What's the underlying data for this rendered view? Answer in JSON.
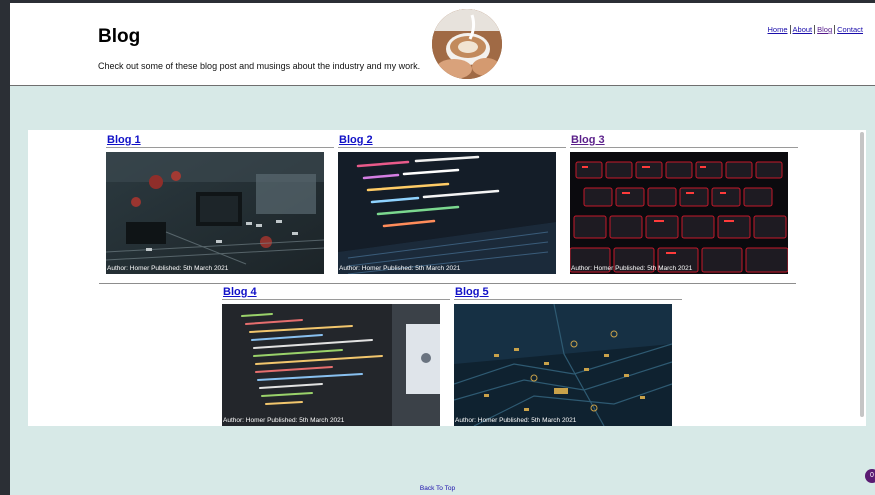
{
  "header": {
    "title": "Blog",
    "description": "Check out some of these blog post and musings about the industry and my work.",
    "image_icon": "coffee-cup-icon"
  },
  "nav": {
    "items": [
      "Home",
      "About",
      "Blog",
      "Contact"
    ]
  },
  "posts": [
    {
      "title": "Blog 1",
      "caption": "Author: Homer Published: 5th March 2021",
      "image": "circuit-board"
    },
    {
      "title": "Blog 2",
      "caption": "Author: Homer Published: 5th March 2021",
      "image": "laptop-code"
    },
    {
      "title": "Blog 3",
      "caption": "Author: Homer Published: 5th March 2021",
      "image": "red-keyboard"
    },
    {
      "title": "Blog 4",
      "caption": "Author: Homer Published: 5th March 2021",
      "image": "code-screen"
    },
    {
      "title": "Blog 5",
      "caption": "Author: Homer Published: 5th March 2021",
      "image": "blue-pcb"
    }
  ],
  "footer": {
    "back_to_top": "Back To Top",
    "badge": "0"
  },
  "colors": {
    "page_background": "#d7e9e7",
    "link": "#1111c7",
    "visited_link": "#5b1f8a"
  }
}
